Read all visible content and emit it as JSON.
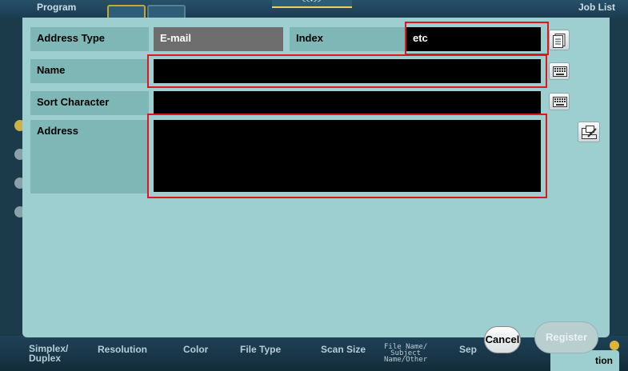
{
  "background": {
    "top_left_label": "Program",
    "top_right_label": "Job List",
    "top_center_marker": "<<•>>",
    "bottom_labels": {
      "simplex_duplex": "Simplex/\nDuplex",
      "resolution": "Resolution",
      "color": "Color",
      "file_type": "File Type",
      "scan_size": "Scan Size",
      "file_name": "File Name/\nSubject\nName/Other",
      "separate": "Sep",
      "application": "tion"
    }
  },
  "form": {
    "address_type_label": "Address Type",
    "address_type_value": "E-mail",
    "index_label": "Index",
    "index_value": "etc",
    "name_label": "Name",
    "name_value": "",
    "sort_character_label": "Sort Character",
    "sort_character_value": "",
    "address_label": "Address",
    "address_value": ""
  },
  "buttons": {
    "cancel": "Cancel",
    "register": "Register"
  },
  "colors": {
    "dialog_bg": "#9ecfd0",
    "label_bg": "#7fb6b6",
    "highlight": "#e0161b"
  }
}
